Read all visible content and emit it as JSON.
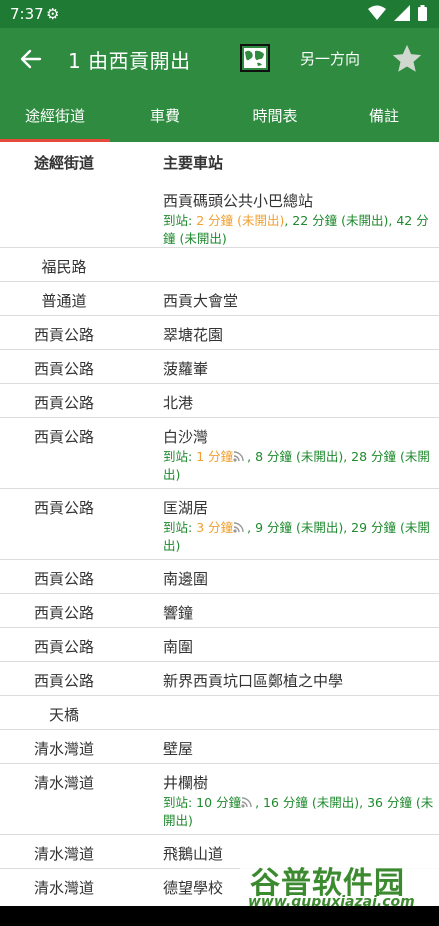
{
  "status_bar": {
    "time": "7:37"
  },
  "app_bar": {
    "title": "1 由西貢開出",
    "direction_label": "另一方向"
  },
  "tabs": [
    {
      "label": "途經街道"
    },
    {
      "label": "車費"
    },
    {
      "label": "時間表"
    },
    {
      "label": "備註"
    }
  ],
  "header": {
    "street": "途經街道",
    "stop": "主要車站"
  },
  "rows": [
    {
      "street": "",
      "stop": "西貢碼頭公共小巴總站",
      "eta_prefix": "到站: ",
      "eta_orange": "2 分鐘 (未開出)",
      "eta_rest": ", 22 分鐘 (未開出), 42 分鐘 (未開出)"
    },
    {
      "street": "福民路",
      "stop": ""
    },
    {
      "street": "普通道",
      "stop": "西貢大會堂"
    },
    {
      "street": "西貢公路",
      "stop": "翠塘花園"
    },
    {
      "street": "西貢公路",
      "stop": "菠蘿輋"
    },
    {
      "street": "西貢公路",
      "stop": "北港"
    },
    {
      "street": "西貢公路",
      "stop": "白沙灣",
      "eta_prefix": "到站: ",
      "eta_orange": "1 分鐘",
      "eta_rest": ", 8 分鐘 (未開出), 28 分鐘 (未開出)"
    },
    {
      "street": "西貢公路",
      "stop": "匡湖居",
      "eta_prefix": "到站: ",
      "eta_orange": "3 分鐘",
      "eta_rest": ", 9 分鐘 (未開出), 29 分鐘 (未開出)"
    },
    {
      "street": "西貢公路",
      "stop": "南邊圍"
    },
    {
      "street": "西貢公路",
      "stop": "響鐘"
    },
    {
      "street": "西貢公路",
      "stop": "南圍"
    },
    {
      "street": "西貢公路",
      "stop": "新界西貢坑口區鄭植之中學"
    },
    {
      "street": "天橋",
      "stop": ""
    },
    {
      "street": "清水灣道",
      "stop": "壁屋"
    },
    {
      "street": "清水灣道",
      "stop": "井欄樹",
      "eta_prefix": "到站: 10 分鐘",
      "eta_orange": "",
      "eta_rest": ", 16 分鐘 (未開出), 36 分鐘 (未開出)"
    },
    {
      "street": "清水灣道",
      "stop": "飛鵝山道"
    },
    {
      "street": "清水灣道",
      "stop": "德望學校"
    }
  ],
  "watermark": {
    "top": "谷普软件园",
    "bottom": "www.gupuxiazai.com"
  },
  "colors": {
    "primary": "#2e8b3f",
    "status": "#1f7a34",
    "indicator": "#e64a3b",
    "eta_green": "#1f8a2e",
    "eta_orange": "#f0a030"
  }
}
